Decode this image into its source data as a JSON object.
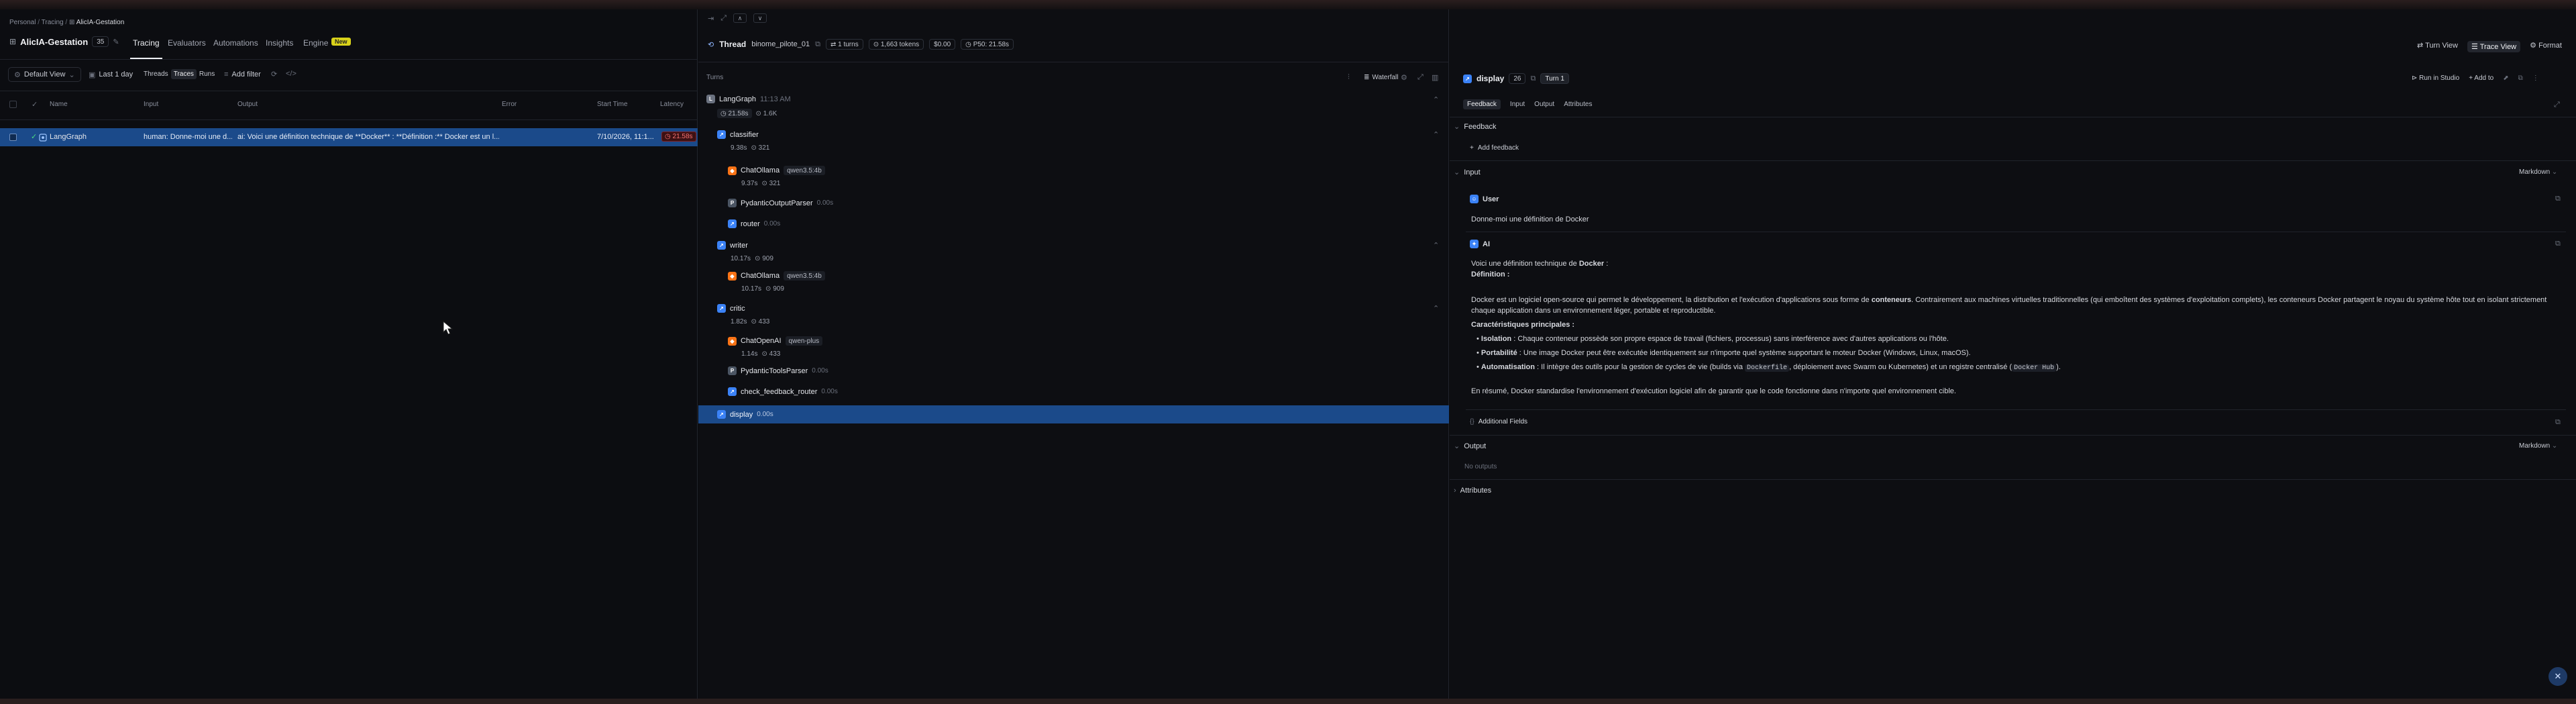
{
  "breadcrumb": [
    "Personal",
    "Tracing",
    "AlicIA-Gestation"
  ],
  "project": {
    "title": "AlicIA-Gestation",
    "count": "35"
  },
  "nav_tabs": [
    "Tracing",
    "Evaluators",
    "Automations",
    "Insights",
    "Engine"
  ],
  "nav_badge": "New",
  "filters": {
    "view": "Default View",
    "time": "Last 1 day",
    "toggle": [
      "Threads",
      "Traces",
      "Runs"
    ],
    "add_filter": "Add filter"
  },
  "table": {
    "headers": [
      "Name",
      "Input",
      "Output",
      "Error",
      "Start Time",
      "Latency"
    ],
    "rows": [
      {
        "name": "LangGraph",
        "input": "human: Donne-moi une d...",
        "output": "ai: Voici une définition technique de **Docker** : **Définition :** Docker est un l...",
        "error": "",
        "start": "7/10/2026, 11:1...",
        "latency": "21.58s"
      }
    ]
  },
  "thread": {
    "label": "Thread",
    "name": "binome_pilote_01",
    "turns": "1 turns",
    "tokens": "1,663 tokens",
    "cost": "$0.00",
    "p50": "P50: 21.58s",
    "turn_view": "Turn View",
    "trace_view": "Trace View",
    "format": "Format"
  },
  "turns_panel": {
    "title": "Turns",
    "waterfall": "Waterfall"
  },
  "tree": {
    "root": {
      "name": "LangGraph",
      "time": "11:13 AM",
      "latency": "21.58s",
      "tokens": "1.6K"
    },
    "classifier": {
      "name": "classifier",
      "latency": "9.38s",
      "tokens": "321"
    },
    "chatollama1": {
      "name": "ChatOllama",
      "model": "qwen3.5:4b",
      "latency": "9.37s",
      "tokens": "321"
    },
    "pydantic_output": {
      "name": "PydanticOutputParser",
      "latency": "0.00s"
    },
    "router": {
      "name": "router",
      "latency": "0.00s"
    },
    "writer": {
      "name": "writer",
      "latency": "10.17s",
      "tokens": "909"
    },
    "chatollama2": {
      "name": "ChatOllama",
      "model": "qwen3.5:4b",
      "latency": "10.17s",
      "tokens": "909"
    },
    "critic": {
      "name": "critic",
      "latency": "1.82s",
      "tokens": "433"
    },
    "chatopenai": {
      "name": "ChatOpenAI",
      "model": "qwen-plus",
      "latency": "1.14s",
      "tokens": "433"
    },
    "pydantic_tools": {
      "name": "PydanticToolsParser",
      "latency": "0.00s"
    },
    "check_feedback": {
      "name": "check_feedback_router",
      "latency": "0.00s"
    },
    "display": {
      "name": "display",
      "latency": "0.00s"
    }
  },
  "detail": {
    "title": "display",
    "count": "26",
    "turn": "Turn 1",
    "run_in_studio": "Run in Studio",
    "add_to": "Add to",
    "tabs": [
      "Feedback",
      "Input",
      "Output",
      "Attributes"
    ],
    "feedback_section": "Feedback",
    "add_feedback": "Add feedback",
    "input_section": "Input",
    "markdown": "Markdown",
    "user_label": "User",
    "user_message": "Donne-moi une définition de Docker",
    "ai_label": "AI",
    "ai_intro_pre": "Voici une définition technique de ",
    "ai_intro_bold": "Docker",
    "ai_intro_post": " :",
    "def_heading": "Définition :",
    "def_p1": "Docker est un logiciel open-source qui permet le développement, la distribution et l'exécution d'applications sous forme de ",
    "def_p1_bold": "conteneurs",
    "def_p1_post": ". Contrairement aux machines virtuelles traditionnelles (qui emboîtent des systèmes d'exploitation complets), les conteneurs Docker partagent le noyau du système hôte tout en isolant strictement",
    "def_p2": "chaque application dans un environnement léger, portable et reproductible.",
    "features_heading": "Caractéristiques principales :",
    "bullet1_label": "Isolation",
    "bullet1_text": " : Chaque conteneur possède son propre espace de travail (fichiers, processus) sans interférence avec d'autres applications ou l'hôte.",
    "bullet2_label": "Portabilité",
    "bullet2_text": " : Une image Docker peut être exécutée identiquement sur n'importe quel système supportant le moteur Docker (Windows, Linux, macOS).",
    "bullet3_label": "Automatisation",
    "bullet3_pre": " : Il intègre des outils pour la gestion de cycles de vie (builds via ",
    "bullet3_code1": "Dockerfile",
    "bullet3_mid": ", déploiement avec Swarm ou Kubernetes) et un registre centralisé (",
    "bullet3_code2": "Docker Hub",
    "bullet3_post": ").",
    "summary": "En résumé, Docker standardise l'environnement d'exécution logiciel afin de garantir que le code fonctionne dans n'importe quel environnement cible.",
    "additional_fields": "Additional Fields",
    "output_section": "Output",
    "no_outputs": "No outputs",
    "attributes_section": "Attributes"
  },
  "colors": {
    "selected_row": "#1b4a8a",
    "accent_blue": "#3b82f6",
    "accent_orange": "#f97316",
    "latency_red": "#ef4444",
    "badge_yellow": "#d9d21a"
  }
}
